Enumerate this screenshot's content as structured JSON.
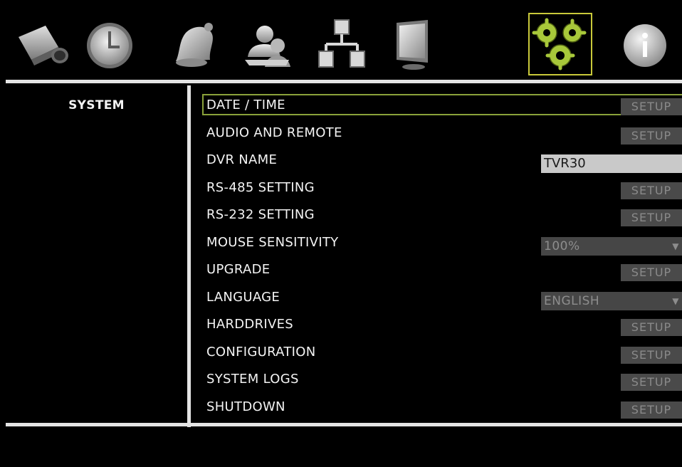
{
  "toolbar": {
    "icons": [
      {
        "name": "camera-icon"
      },
      {
        "name": "clock-icon"
      },
      {
        "name": "alarm-bell-icon"
      },
      {
        "name": "users-icon"
      },
      {
        "name": "network-icon"
      },
      {
        "name": "monitor-icon"
      },
      {
        "name": "system-gears-icon",
        "selected": true
      },
      {
        "name": "info-icon"
      }
    ],
    "selected_highlight_color": "#c9c93a"
  },
  "sidebar": {
    "selected": "SYSTEM"
  },
  "settings": {
    "rows": [
      {
        "label": "DATE / TIME",
        "control": "button",
        "button_label": "SETUP",
        "selected": true
      },
      {
        "label": "AUDIO AND REMOTE",
        "control": "button",
        "button_label": "SETUP"
      },
      {
        "label": "DVR NAME",
        "control": "text",
        "value": "TVR30"
      },
      {
        "label": "RS-485 SETTING",
        "control": "button",
        "button_label": "SETUP"
      },
      {
        "label": "RS-232 SETTING",
        "control": "button",
        "button_label": "SETUP"
      },
      {
        "label": "MOUSE SENSITIVITY",
        "control": "select",
        "value": "100%"
      },
      {
        "label": "UPGRADE",
        "control": "button",
        "button_label": "SETUP"
      },
      {
        "label": "LANGUAGE",
        "control": "select",
        "value": "ENGLISH"
      },
      {
        "label": "HARDDRIVES",
        "control": "button",
        "button_label": "SETUP"
      },
      {
        "label": "CONFIGURATION",
        "control": "button",
        "button_label": "SETUP"
      },
      {
        "label": "SYSTEM LOGS",
        "control": "button",
        "button_label": "SETUP"
      },
      {
        "label": "SHUTDOWN",
        "control": "button",
        "button_label": "SETUP"
      }
    ],
    "selection_color": "#8aa23a"
  }
}
